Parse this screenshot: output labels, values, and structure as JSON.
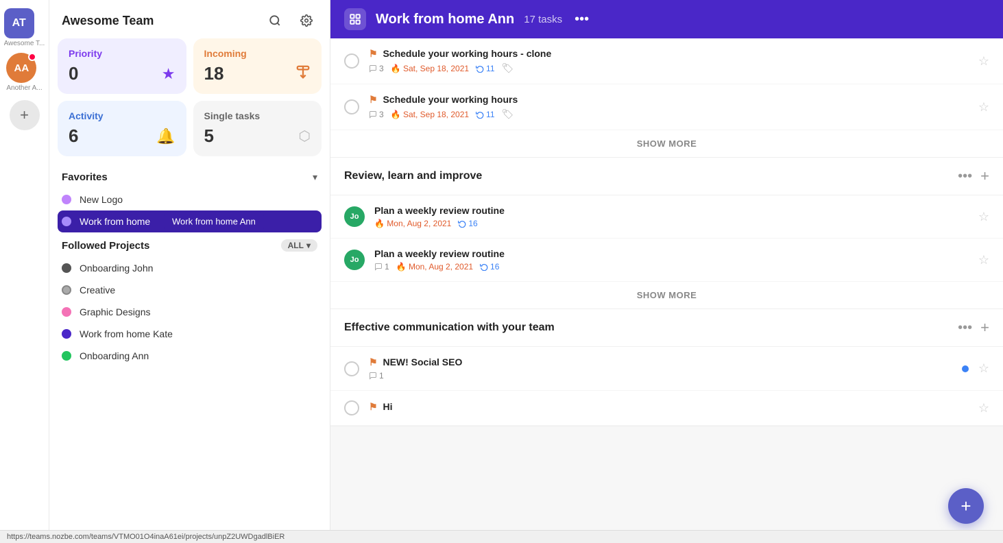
{
  "sidebar_icons": {
    "team_initials": "AT",
    "team_label": "Awesome T...",
    "user_initials": "AA",
    "user_label": "Another A..."
  },
  "left_panel": {
    "title": "Awesome Team",
    "stats": {
      "priority": {
        "label": "Priority",
        "value": "0",
        "icon": "★"
      },
      "incoming": {
        "label": "Incoming",
        "value": "18",
        "icon": "↓"
      },
      "activity": {
        "label": "Activity",
        "value": "6",
        "icon": "🔔"
      },
      "single": {
        "label": "Single tasks",
        "value": "5",
        "icon": "⬣"
      }
    },
    "favorites_label": "Favorites",
    "favorites": [
      {
        "label": "New Logo",
        "color": "#c084fc"
      },
      {
        "label": "Work from home",
        "color": "#4a27c8",
        "active": true
      }
    ],
    "followed_label": "Followed Projects",
    "all_label": "ALL",
    "followed": [
      {
        "label": "Onboarding John",
        "color": "#666"
      },
      {
        "label": "Creative",
        "color": "#a0a0a0"
      },
      {
        "label": "Graphic Designs",
        "color": "#f472b6"
      },
      {
        "label": "Work from home Kate",
        "color": "#4a27c8"
      },
      {
        "label": "Onboarding Ann",
        "color": "#22c55e"
      }
    ],
    "tooltip": "Work from home Ann"
  },
  "right_panel": {
    "header": {
      "title": "Work from home Ann",
      "task_count": "17 tasks",
      "more": "•••"
    },
    "sections": [
      {
        "name": "",
        "tasks": [
          {
            "id": "t1",
            "name": "Schedule your working hours - clone",
            "comments": "3",
            "date": "Sat, Sep 18, 2021",
            "cycles": "11",
            "has_tag": true,
            "has_avatar": false,
            "starred": false
          },
          {
            "id": "t2",
            "name": "Schedule your working hours",
            "comments": "3",
            "date": "Sat, Sep 18, 2021",
            "cycles": "11",
            "has_tag": true,
            "has_avatar": false,
            "starred": false
          }
        ],
        "show_more": "SHOW MORE"
      },
      {
        "name": "Review, learn and improve",
        "tasks": [
          {
            "id": "t3",
            "name": "Plan a weekly review routine",
            "comments": "",
            "date": "Mon, Aug 2, 2021",
            "cycles": "16",
            "has_tag": false,
            "has_avatar": true,
            "avatar_initials": "Jo",
            "avatar_color": "#27a865",
            "starred": false
          },
          {
            "id": "t4",
            "name": "Plan a weekly review routine",
            "comments": "1",
            "date": "Mon, Aug 2, 2021",
            "cycles": "16",
            "has_tag": false,
            "has_avatar": true,
            "avatar_initials": "Jo",
            "avatar_color": "#27a865",
            "starred": false
          }
        ],
        "show_more": "SHOW MORE"
      },
      {
        "name": "Effective communication with your team",
        "tasks": [
          {
            "id": "t5",
            "name": "NEW! Social SEO",
            "comments": "1",
            "date": "",
            "cycles": "",
            "has_tag": false,
            "has_avatar": false,
            "starred": false,
            "has_blue_dot": true
          },
          {
            "id": "t6",
            "name": "Hi",
            "comments": "",
            "date": "",
            "cycles": "",
            "has_tag": false,
            "has_avatar": false,
            "starred": false
          }
        ],
        "show_more": ""
      }
    ]
  },
  "url_bar": "https://teams.nozbe.com/teams/VTMO01O4inaA61ei/projects/unpZ2UWDgadlBiER",
  "fab": "+"
}
